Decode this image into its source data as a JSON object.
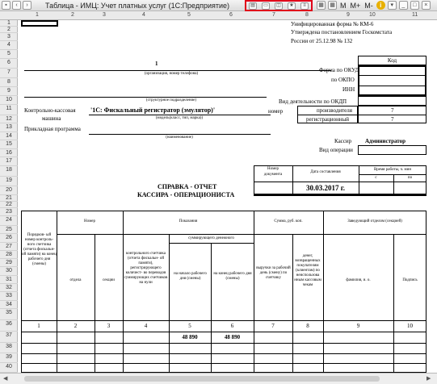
{
  "window": {
    "title": "Таблица - ИМЦ: Учет платных услуг  (1С:Предприятие)",
    "toolbar_right": [
      "M",
      "M+",
      "M-"
    ]
  },
  "columns": [
    "1",
    "2",
    "3",
    "4",
    "5",
    "6",
    "7",
    "8",
    "9",
    "10",
    "11"
  ],
  "rows": [
    "1",
    "2",
    "3",
    "4",
    "5",
    "6",
    "7",
    "8",
    "9",
    "10",
    "11",
    "12",
    "13",
    "14",
    "15",
    "16",
    "17",
    "18",
    "19",
    "20",
    "21",
    "22",
    "23",
    "24",
    "25",
    "26",
    "27",
    "28",
    "29",
    "30",
    "31",
    "32",
    "33",
    "34",
    "35",
    "36",
    "37",
    "38",
    "39",
    "40"
  ],
  "form": {
    "header_lines": [
      "Унифицированная форма № КМ-6",
      "Утверждена постановлением Госкомстата",
      "России от 25.12.98 № 132"
    ],
    "code_label": "Код",
    "okud_label": "Форма по ОКУД",
    "okpo_label": "по ОКПО",
    "inn_label": "ИНН",
    "org_value": "1",
    "org_caption": "(организация, номер телефона)",
    "subdivision_caption": "(структурное подразделение)",
    "okdp_label": "Вид деятельности по ОКДП",
    "kkm_label_1": "Контрольно-кассовая",
    "kkm_label_2": "машина",
    "kkm_value": "'1С: Фискальный регистратор (эмулятор)'",
    "kkm_caption": "(модель(класс, тип, марка))",
    "number_label": "номер",
    "manufacturer_label": "производителя",
    "manufacturer_value": "7",
    "registration_label": "регистрационный",
    "registration_value": "7",
    "program_label": "Прикладная программа",
    "program_caption": "(наименование)",
    "cashier_label": "Кассир",
    "cashier_value": "Администратор",
    "operation_label": "Вид операции",
    "doc_number_label_1": "Номер",
    "doc_number_label_2": "документа",
    "date_label": "Дата составления",
    "work_time_label": "Время работы, ч. мин",
    "from_label": "с",
    "to_label": "по",
    "date_value": "30.03.2017 г.",
    "title_1": "СПРАВКА - ОТЧЕТ",
    "title_2": "КАССИРА - ОПЕРАЦИОНИСТА"
  },
  "table": {
    "col1_header": "Порядков- ый номер контроль- ного счетчика (отчета фискальн- ой памяти) на конец рабочего дня (смены)",
    "number_header": "Номер",
    "dept_header": "отдела",
    "section_header": "секции",
    "readings_header": "Показания",
    "counter_header": "контрольного счетчика (отчета фискальн- ой памяти), регистрирующего количест- во переводов суммирующих счетчиков на нули",
    "summing_header": "суммирующего денежного",
    "start_header": "на начало рабочего дня (смены)",
    "end_header": "на конец рабочего дня (смены)",
    "amount_header": "Сумма, руб. коп.",
    "revenue_header": "выручки за рабочий день (смену) по счетчику",
    "returned_header": "денег, возвращенных покупателям (клиентам) по неиспользова нным кассовым чекам",
    "head_header": "Заведующий отделом (секцией)",
    "name_header": "фамилия, и. о.",
    "signature_header": "Подпись",
    "column_numbers": [
      "1",
      "2",
      "3",
      "4",
      "5",
      "6",
      "7",
      "8",
      "9",
      "10"
    ],
    "row36_start": "48 890",
    "row36_end": "48 890"
  }
}
